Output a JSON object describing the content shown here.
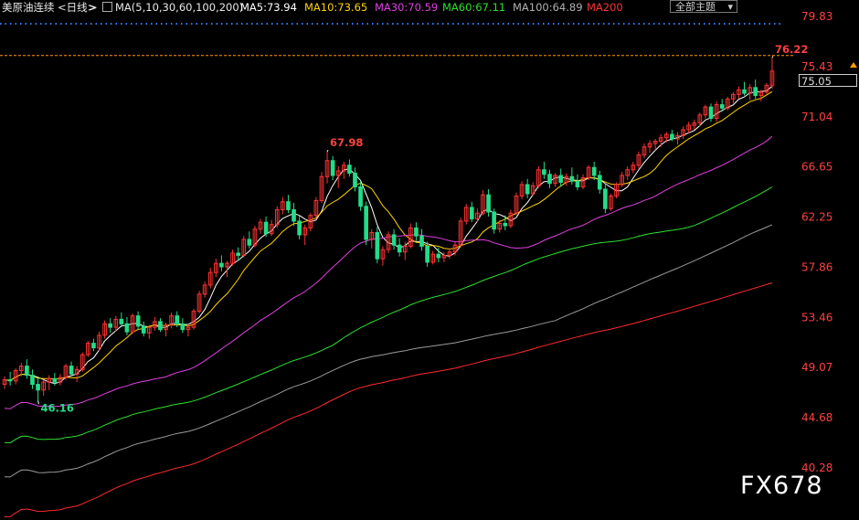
{
  "header": {
    "title": "美原油连续",
    "period": "<日线>",
    "nav_arrow": ">",
    "ma_icon": "ma-settings-icon",
    "ma_set": "MA(5,10,30,60,100,200)",
    "ma5": "MA5:73.94",
    "ma10": "MA10:73.65",
    "ma30": "MA30:70.59",
    "ma60": "MA60:67.11",
    "ma100": "MA100:64.89",
    "ma200": "MA200",
    "selector": "全部主题",
    "selector_icon": "chevron-down-icon"
  },
  "current_price": "75.05",
  "watermark": "FX678",
  "colors": {
    "up": "#ff3333",
    "down": "#22dd88",
    "ma5": "#ffffff",
    "ma10": "#ffd400",
    "ma30": "#e040e0",
    "ma60": "#2ee02e",
    "ma100": "#9a9a9a",
    "ma200": "#ff2a2a",
    "axis_text": "#ff4040",
    "grid_dots": "#2a80ff",
    "price_line": "#ff9900"
  },
  "chart_data": {
    "type": "candlestick",
    "y_ticks": [
      "79.83",
      "75.43",
      "71.04",
      "66.65",
      "62.25",
      "57.86",
      "53.46",
      "49.07",
      "44.68",
      "40.28"
    ],
    "ylim": [
      40.28,
      79.83
    ],
    "annotations": {
      "high": "76.22",
      "mid_high": "67.98",
      "low": "46.16"
    },
    "current_price": 75.05,
    "candles": [
      [
        47.6,
        48.3,
        47.2,
        48.0
      ],
      [
        48.0,
        48.7,
        47.5,
        47.9
      ],
      [
        47.9,
        49.0,
        47.6,
        48.8
      ],
      [
        48.8,
        49.5,
        48.3,
        49.2
      ],
      [
        49.2,
        49.8,
        48.1,
        48.4
      ],
      [
        48.4,
        48.9,
        47.2,
        47.6
      ],
      [
        47.6,
        48.2,
        46.16,
        47.1
      ],
      [
        47.1,
        48.0,
        46.6,
        47.8
      ],
      [
        47.8,
        48.4,
        47.1,
        48.1
      ],
      [
        48.1,
        48.6,
        47.5,
        47.8
      ],
      [
        47.8,
        48.5,
        47.5,
        48.2
      ],
      [
        48.2,
        49.4,
        48.0,
        49.2
      ],
      [
        49.2,
        49.6,
        48.3,
        48.5
      ],
      [
        48.5,
        49.2,
        47.8,
        48.9
      ],
      [
        48.9,
        50.4,
        48.7,
        50.2
      ],
      [
        50.2,
        51.4,
        50.0,
        51.2
      ],
      [
        51.2,
        51.6,
        50.5,
        50.8
      ],
      [
        50.8,
        52.2,
        50.5,
        51.9
      ],
      [
        51.9,
        53.2,
        51.6,
        52.9
      ],
      [
        52.9,
        53.4,
        52.1,
        52.6
      ],
      [
        52.6,
        53.6,
        52.2,
        53.3
      ],
      [
        53.3,
        53.9,
        52.6,
        52.9
      ],
      [
        52.9,
        53.5,
        51.9,
        52.2
      ],
      [
        52.2,
        53.8,
        52.0,
        53.6
      ],
      [
        53.6,
        54.0,
        52.4,
        52.7
      ],
      [
        52.7,
        53.1,
        51.8,
        52.1
      ],
      [
        52.1,
        52.8,
        51.6,
        52.6
      ],
      [
        52.6,
        53.5,
        52.3,
        53.1
      ],
      [
        53.1,
        53.4,
        52.2,
        52.4
      ],
      [
        52.4,
        53.0,
        51.8,
        52.8
      ],
      [
        52.8,
        53.9,
        52.5,
        53.6
      ],
      [
        53.6,
        54.0,
        52.6,
        52.9
      ],
      [
        52.9,
        53.4,
        52.1,
        52.4
      ],
      [
        52.4,
        52.9,
        51.8,
        52.6
      ],
      [
        52.6,
        54.2,
        52.4,
        54.0
      ],
      [
        54.0,
        55.8,
        53.8,
        55.5
      ],
      [
        55.5,
        56.6,
        55.2,
        56.3
      ],
      [
        56.3,
        57.8,
        56.0,
        57.4
      ],
      [
        57.4,
        58.6,
        57.0,
        58.2
      ],
      [
        58.2,
        58.9,
        57.5,
        57.9
      ],
      [
        57.9,
        58.4,
        57.0,
        58.2
      ],
      [
        58.2,
        59.4,
        58.0,
        59.1
      ],
      [
        59.1,
        59.6,
        58.4,
        58.9
      ],
      [
        58.9,
        60.6,
        58.7,
        60.3
      ],
      [
        60.3,
        61.0,
        59.5,
        59.8
      ],
      [
        59.8,
        61.5,
        59.6,
        61.2
      ],
      [
        61.2,
        62.1,
        60.8,
        61.8
      ],
      [
        61.8,
        62.3,
        60.5,
        60.8
      ],
      [
        60.8,
        62.0,
        60.6,
        61.6
      ],
      [
        61.6,
        63.2,
        61.3,
        62.9
      ],
      [
        62.9,
        64.0,
        62.5,
        63.6
      ],
      [
        63.6,
        64.2,
        62.6,
        62.9
      ],
      [
        62.9,
        63.5,
        61.5,
        61.9
      ],
      [
        61.9,
        62.4,
        60.3,
        60.7
      ],
      [
        60.7,
        61.6,
        59.8,
        61.3
      ],
      [
        61.3,
        62.6,
        61.0,
        62.4
      ],
      [
        62.4,
        64.0,
        62.1,
        63.7
      ],
      [
        63.7,
        66.2,
        63.5,
        65.8
      ],
      [
        65.8,
        67.98,
        65.2,
        67.2
      ],
      [
        67.2,
        67.6,
        65.5,
        65.9
      ],
      [
        65.9,
        66.7,
        64.8,
        66.3
      ],
      [
        66.3,
        67.1,
        65.6,
        66.8
      ],
      [
        66.8,
        67.3,
        65.8,
        66.1
      ],
      [
        66.1,
        66.6,
        64.5,
        64.9
      ],
      [
        64.9,
        65.4,
        62.8,
        63.2
      ],
      [
        63.2,
        63.6,
        59.8,
        60.3
      ],
      [
        60.3,
        61.2,
        59.5,
        60.9
      ],
      [
        60.9,
        61.4,
        58.2,
        58.6
      ],
      [
        58.6,
        59.7,
        58.0,
        59.4
      ],
      [
        59.4,
        61.0,
        59.1,
        60.7
      ],
      [
        60.7,
        61.2,
        59.4,
        59.8
      ],
      [
        59.8,
        60.4,
        58.8,
        59.2
      ],
      [
        59.2,
        60.1,
        58.5,
        59.7
      ],
      [
        59.7,
        61.7,
        59.5,
        61.3
      ],
      [
        61.3,
        61.8,
        60.2,
        60.6
      ],
      [
        60.6,
        61.2,
        59.3,
        59.7
      ],
      [
        59.7,
        60.1,
        57.9,
        58.3
      ],
      [
        58.3,
        59.3,
        58.1,
        59.0
      ],
      [
        59.0,
        59.6,
        58.3,
        58.7
      ],
      [
        58.7,
        59.2,
        58.3,
        58.9
      ],
      [
        58.9,
        59.5,
        58.6,
        59.2
      ],
      [
        59.2,
        60.1,
        58.9,
        59.8
      ],
      [
        59.8,
        62.2,
        59.6,
        61.9
      ],
      [
        61.9,
        63.4,
        61.6,
        63.1
      ],
      [
        63.1,
        63.6,
        61.8,
        62.1
      ],
      [
        62.1,
        63.0,
        61.8,
        62.6
      ],
      [
        62.6,
        64.6,
        62.4,
        64.2
      ],
      [
        64.2,
        64.7,
        62.3,
        62.7
      ],
      [
        62.7,
        63.0,
        60.8,
        61.2
      ],
      [
        61.2,
        62.0,
        60.9,
        61.7
      ],
      [
        61.7,
        62.4,
        61.1,
        61.5
      ],
      [
        61.5,
        62.9,
        61.3,
        62.6
      ],
      [
        62.6,
        64.4,
        62.4,
        64.1
      ],
      [
        64.1,
        65.4,
        63.8,
        65.1
      ],
      [
        65.1,
        65.6,
        63.9,
        64.3
      ],
      [
        64.3,
        65.3,
        64.1,
        65.0
      ],
      [
        65.0,
        66.7,
        64.8,
        66.4
      ],
      [
        66.4,
        67.1,
        65.6,
        66.0
      ],
      [
        66.0,
        66.4,
        64.8,
        65.2
      ],
      [
        65.2,
        66.1,
        64.9,
        65.9
      ],
      [
        65.9,
        66.5,
        64.9,
        65.3
      ],
      [
        65.3,
        66.1,
        65.0,
        65.8
      ],
      [
        65.8,
        66.6,
        65.1,
        65.4
      ],
      [
        65.4,
        66.0,
        64.6,
        64.9
      ],
      [
        64.9,
        66.0,
        64.7,
        65.7
      ],
      [
        65.7,
        66.8,
        65.5,
        66.6
      ],
      [
        66.6,
        67.1,
        65.5,
        65.9
      ],
      [
        65.9,
        66.3,
        64.3,
        64.7
      ],
      [
        64.7,
        65.1,
        62.6,
        63.0
      ],
      [
        63.0,
        64.3,
        62.8,
        64.1
      ],
      [
        64.1,
        65.3,
        63.9,
        65.1
      ],
      [
        65.1,
        66.2,
        64.9,
        65.9
      ],
      [
        65.9,
        66.7,
        65.5,
        66.4
      ],
      [
        66.4,
        67.1,
        66.1,
        66.8
      ],
      [
        66.8,
        68.0,
        66.5,
        67.7
      ],
      [
        67.7,
        68.7,
        67.4,
        68.4
      ],
      [
        68.4,
        69.0,
        67.9,
        68.7
      ],
      [
        68.7,
        69.1,
        68.1,
        68.9
      ],
      [
        68.9,
        69.5,
        68.4,
        69.2
      ],
      [
        69.2,
        69.7,
        68.8,
        69.5
      ],
      [
        69.5,
        69.9,
        68.9,
        69.1
      ],
      [
        69.1,
        69.7,
        68.6,
        69.4
      ],
      [
        69.4,
        70.2,
        69.1,
        69.9
      ],
      [
        69.9,
        70.6,
        69.6,
        70.3
      ],
      [
        70.3,
        70.8,
        69.9,
        70.5
      ],
      [
        70.5,
        71.4,
        70.2,
        71.2
      ],
      [
        71.2,
        72.1,
        70.9,
        71.9
      ],
      [
        71.9,
        72.2,
        70.6,
        70.9
      ],
      [
        70.9,
        72.4,
        70.6,
        72.1
      ],
      [
        72.1,
        72.6,
        71.5,
        71.8
      ],
      [
        71.8,
        72.8,
        71.6,
        72.6
      ],
      [
        72.6,
        73.2,
        72.2,
        73.0
      ],
      [
        73.0,
        73.7,
        72.6,
        73.4
      ],
      [
        73.4,
        74.1,
        72.9,
        73.1
      ],
      [
        73.1,
        73.9,
        72.5,
        73.6
      ],
      [
        73.6,
        74.3,
        72.6,
        72.9
      ],
      [
        72.9,
        73.4,
        72.4,
        73.2
      ],
      [
        73.2,
        74.0,
        73.0,
        73.8
      ],
      [
        73.8,
        76.22,
        73.5,
        75.05
      ]
    ]
  }
}
